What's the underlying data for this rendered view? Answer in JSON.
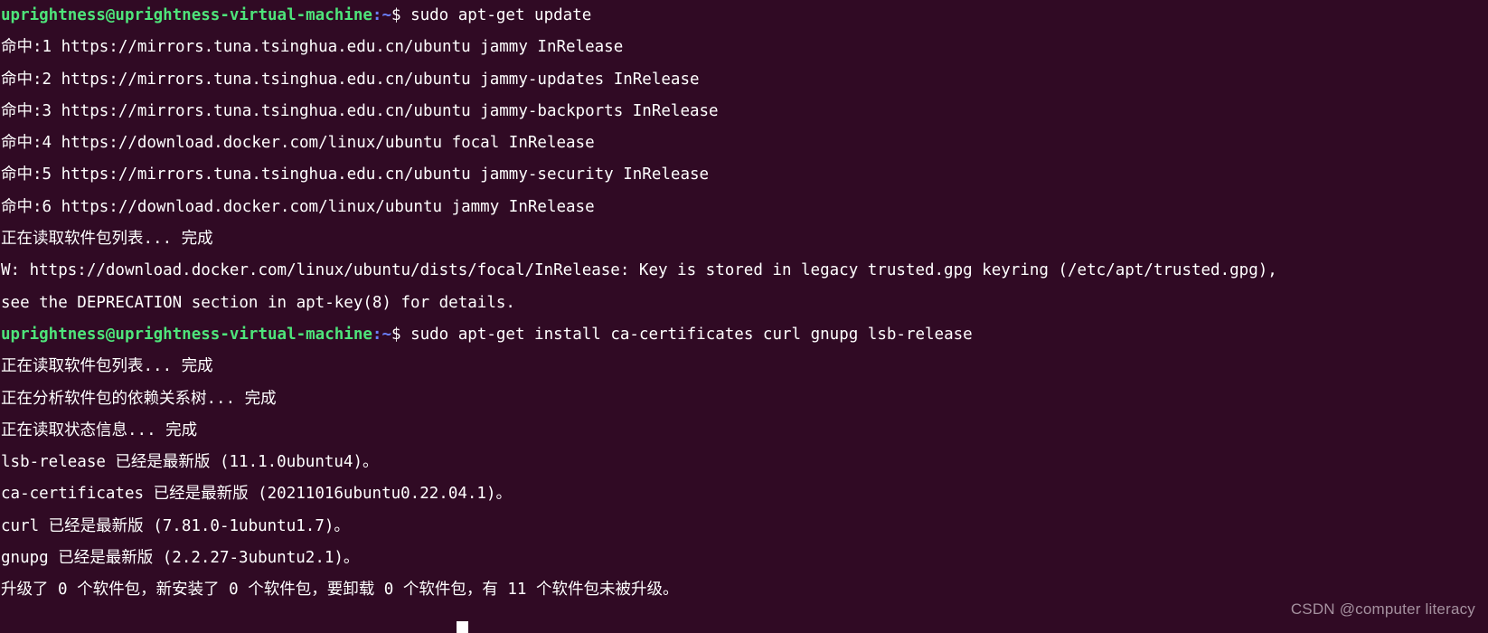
{
  "terminal": {
    "background_color": "#300a24",
    "foreground_color": "#ffffff",
    "prompt_user_color": "#4ee47a",
    "prompt_path_color": "#6a7ffb",
    "cursor_color": "#ffffff",
    "prompt": {
      "user_host": "uprightness@uprightness-virtual-machine",
      "colon": ":",
      "path": "~",
      "dollar": "$ "
    },
    "lines": [
      {
        "type": "prompt",
        "command": "sudo apt-get update"
      },
      {
        "type": "output",
        "text": "命中:1 https://mirrors.tuna.tsinghua.edu.cn/ubuntu jammy InRelease"
      },
      {
        "type": "output",
        "text": "命中:2 https://mirrors.tuna.tsinghua.edu.cn/ubuntu jammy-updates InRelease"
      },
      {
        "type": "output",
        "text": "命中:3 https://mirrors.tuna.tsinghua.edu.cn/ubuntu jammy-backports InRelease"
      },
      {
        "type": "output",
        "text": "命中:4 https://download.docker.com/linux/ubuntu focal InRelease"
      },
      {
        "type": "output",
        "text": "命中:5 https://mirrors.tuna.tsinghua.edu.cn/ubuntu jammy-security InRelease"
      },
      {
        "type": "output",
        "text": "命中:6 https://download.docker.com/linux/ubuntu jammy InRelease"
      },
      {
        "type": "output",
        "text": "正在读取软件包列表... 完成"
      },
      {
        "type": "output",
        "text": "W: https://download.docker.com/linux/ubuntu/dists/focal/InRelease: Key is stored in legacy trusted.gpg keyring (/etc/apt/trusted.gpg),"
      },
      {
        "type": "output",
        "text": "see the DEPRECATION section in apt-key(8) for details."
      },
      {
        "type": "prompt",
        "command": "sudo apt-get install ca-certificates curl gnupg lsb-release"
      },
      {
        "type": "output",
        "text": "正在读取软件包列表... 完成"
      },
      {
        "type": "output",
        "text": "正在分析软件包的依赖关系树... 完成"
      },
      {
        "type": "output",
        "text": "正在读取状态信息... 完成"
      },
      {
        "type": "output",
        "text": "lsb-release 已经是最新版 (11.1.0ubuntu4)。"
      },
      {
        "type": "output",
        "text": "ca-certificates 已经是最新版 (20211016ubuntu0.22.04.1)。"
      },
      {
        "type": "output",
        "text": "curl 已经是最新版 (7.81.0-1ubuntu1.7)。"
      },
      {
        "type": "output",
        "text": "gnupg 已经是最新版 (2.2.27-3ubuntu2.1)。"
      },
      {
        "type": "output",
        "text": "升级了 0 个软件包，新安装了 0 个软件包，要卸载 0 个软件包，有 11 个软件包未被升级。"
      }
    ]
  },
  "watermark": {
    "text": "CSDN @computer literacy"
  }
}
